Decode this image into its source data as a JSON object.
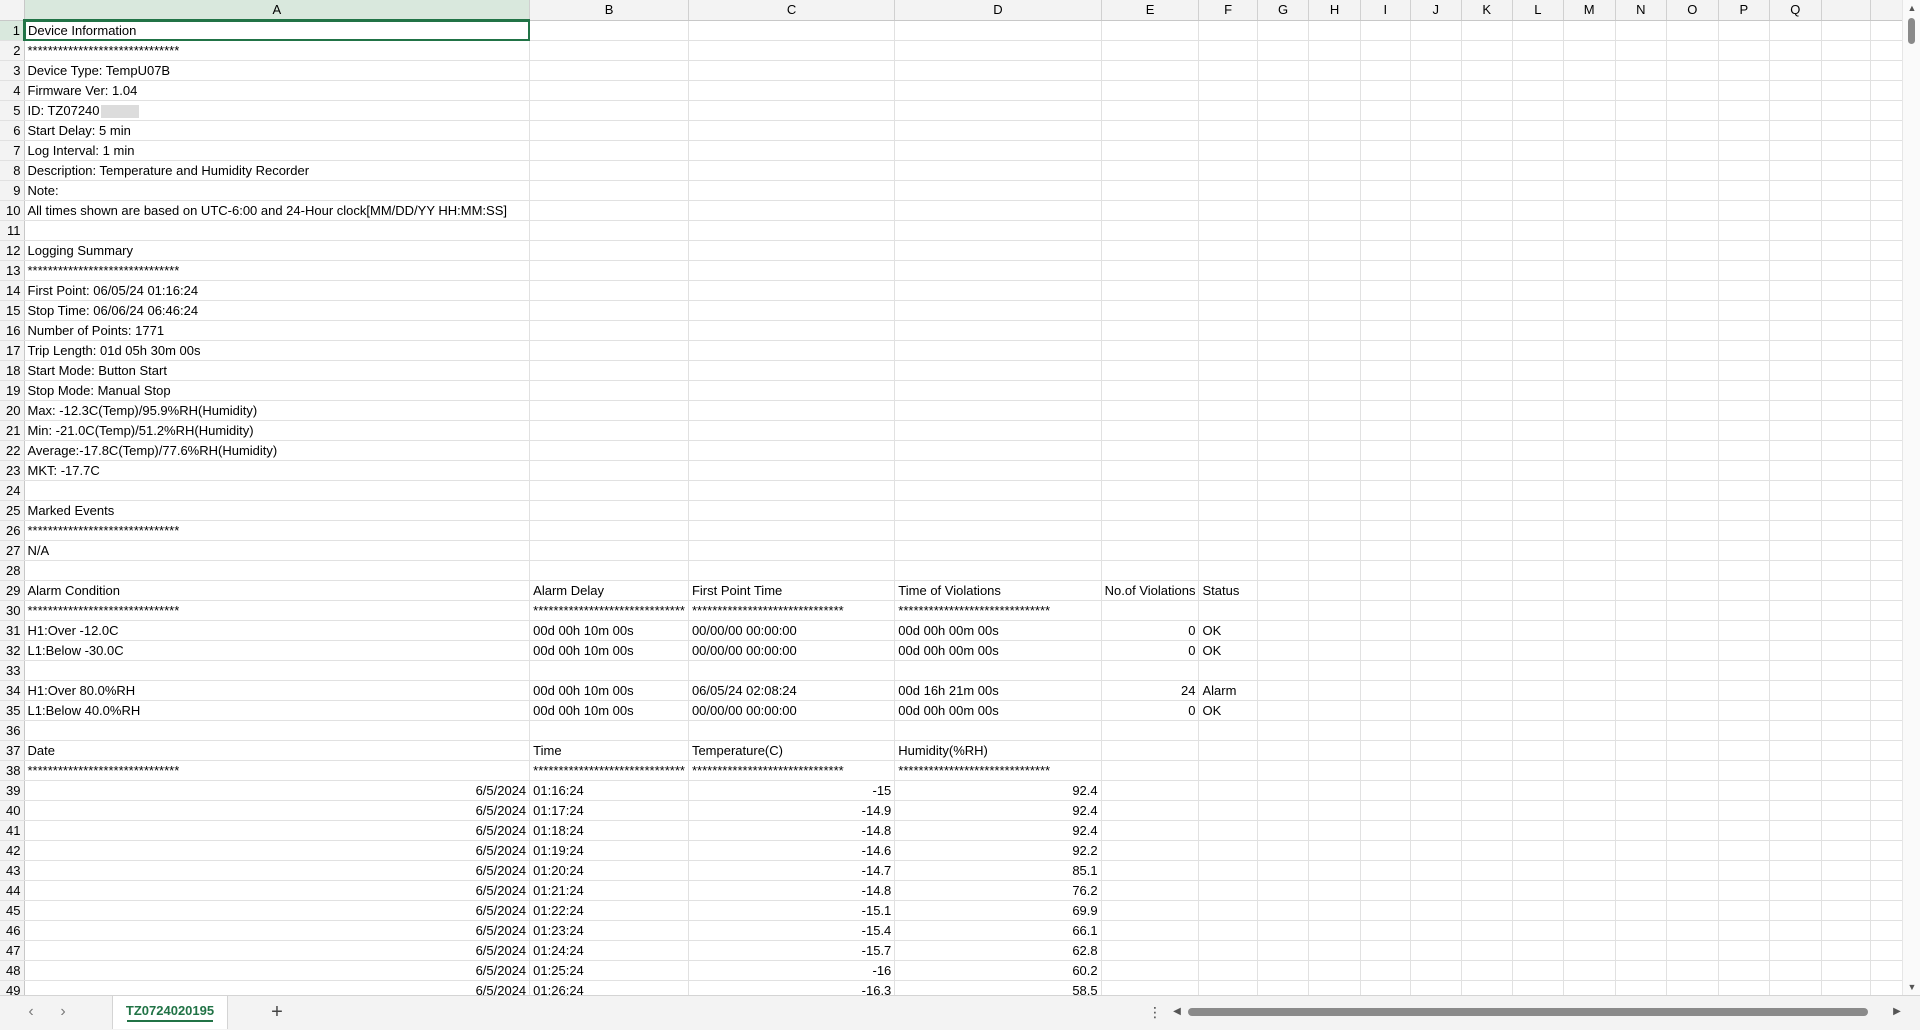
{
  "columns": [
    "A",
    "B",
    "C",
    "D",
    "E",
    "F",
    "G",
    "H",
    "I",
    "J",
    "K",
    "L",
    "M",
    "N",
    "O",
    "P",
    "Q"
  ],
  "active_cell": "A1",
  "rows": [
    {
      "n": "1",
      "a": "Device Information"
    },
    {
      "n": "2",
      "a": "******************************"
    },
    {
      "n": "3",
      "a": "Device Type:    TempU07B"
    },
    {
      "n": "4",
      "a": "Firmware Ver:   1.04"
    },
    {
      "n": "5",
      "a": "ID:          TZ07240",
      "redacted": true
    },
    {
      "n": "6",
      "a": "Start Delay:    5 min"
    },
    {
      "n": "7",
      "a": "Log Interval:   1 min"
    },
    {
      "n": "8",
      "a": "Description:    Temperature and Humidity Recorder"
    },
    {
      "n": "9",
      "a": "Note:"
    },
    {
      "n": "10",
      "a": "All times shown are based on UTC-6:00 and 24-Hour clock[MM/DD/YY HH:MM:SS]"
    },
    {
      "n": "11"
    },
    {
      "n": "12",
      "a": "Logging Summary"
    },
    {
      "n": "13",
      "a": "******************************"
    },
    {
      "n": "14",
      "a": "First Point:   06/05/24 01:16:24"
    },
    {
      "n": "15",
      "a": "Stop Time:     06/06/24 06:46:24"
    },
    {
      "n": "16",
      "a": "Number of Points:   1771"
    },
    {
      "n": "17",
      "a": "Trip Length:   01d 05h 30m 00s"
    },
    {
      "n": "18",
      "a": "Start Mode:    Button Start"
    },
    {
      "n": "19",
      "a": "Stop Mode:     Manual Stop"
    },
    {
      "n": "20",
      "a": "Max:    -12.3C(Temp)/95.9%RH(Humidity)"
    },
    {
      "n": "21",
      "a": "Min:    -21.0C(Temp)/51.2%RH(Humidity)"
    },
    {
      "n": "22",
      "a": "Average:-17.8C(Temp)/77.6%RH(Humidity)"
    },
    {
      "n": "23",
      "a": "MKT:    -17.7C"
    },
    {
      "n": "24"
    },
    {
      "n": "25",
      "a": "Marked Events"
    },
    {
      "n": "26",
      "a": "******************************"
    },
    {
      "n": "27",
      "a": "N/A"
    },
    {
      "n": "28"
    },
    {
      "n": "29",
      "a": "Alarm Condition",
      "b": "Alarm Delay",
      "c": "First Point Time",
      "d": "Time of Violations",
      "e": "No.of Violations",
      "f": "Status"
    },
    {
      "n": "30",
      "a": "******************************",
      "b": "******************************",
      "c": "******************************",
      "d": "******************************"
    },
    {
      "n": "31",
      "a": "H1:Over -12.0C",
      "b": "00d 00h 10m 00s",
      "c": "00/00/00 00:00:00",
      "d": "00d 00h 00m 00s",
      "e": "0",
      "f": "OK"
    },
    {
      "n": "32",
      "a": "L1:Below -30.0C",
      "b": "00d 00h 10m 00s",
      "c": "00/00/00 00:00:00",
      "d": "00d 00h 00m 00s",
      "e": "0",
      "f": "OK"
    },
    {
      "n": "33"
    },
    {
      "n": "34",
      "a": "H1:Over 80.0%RH",
      "b": "00d 00h 10m 00s",
      "c": "06/05/24 02:08:24",
      "d": "00d 16h 21m 00s",
      "e": "24",
      "f": "Alarm"
    },
    {
      "n": "35",
      "a": "L1:Below 40.0%RH",
      "b": "00d 00h 10m 00s",
      "c": "00/00/00 00:00:00",
      "d": "00d 00h 00m 00s",
      "e": "0",
      "f": "OK"
    },
    {
      "n": "36"
    },
    {
      "n": "37",
      "a": "Date",
      "b": "Time",
      "c": "Temperature(C)",
      "d": "Humidity(%RH)"
    },
    {
      "n": "38",
      "a": "******************************",
      "b": "******************************",
      "c": "******************************",
      "d": "******************************"
    },
    {
      "n": "39",
      "a": "6/5/2024",
      "b": "01:16:24",
      "c": "-15",
      "d": "92.4",
      "data": true
    },
    {
      "n": "40",
      "a": "6/5/2024",
      "b": "01:17:24",
      "c": "-14.9",
      "d": "92.4",
      "data": true
    },
    {
      "n": "41",
      "a": "6/5/2024",
      "b": "01:18:24",
      "c": "-14.8",
      "d": "92.4",
      "data": true
    },
    {
      "n": "42",
      "a": "6/5/2024",
      "b": "01:19:24",
      "c": "-14.6",
      "d": "92.2",
      "data": true
    },
    {
      "n": "43",
      "a": "6/5/2024",
      "b": "01:20:24",
      "c": "-14.7",
      "d": "85.1",
      "data": true
    },
    {
      "n": "44",
      "a": "6/5/2024",
      "b": "01:21:24",
      "c": "-14.8",
      "d": "76.2",
      "data": true
    },
    {
      "n": "45",
      "a": "6/5/2024",
      "b": "01:22:24",
      "c": "-15.1",
      "d": "69.9",
      "data": true
    },
    {
      "n": "46",
      "a": "6/5/2024",
      "b": "01:23:24",
      "c": "-15.4",
      "d": "66.1",
      "data": true
    },
    {
      "n": "47",
      "a": "6/5/2024",
      "b": "01:24:24",
      "c": "-15.7",
      "d": "62.8",
      "data": true
    },
    {
      "n": "48",
      "a": "6/5/2024",
      "b": "01:25:24",
      "c": "-16",
      "d": "60.2",
      "data": true
    },
    {
      "n": "49",
      "a": "6/5/2024",
      "b": "01:26:24",
      "c": "-16.3",
      "d": "58.5",
      "data": true
    }
  ],
  "sheet_tab": "TZ0724020195",
  "bottom": {
    "prev_icon": "chevron-left-icon",
    "next_icon": "chevron-right-icon",
    "add_icon": "plus-icon",
    "more_icon": "more-vertical-icon",
    "add_glyph": "+",
    "more_glyph": "⋮"
  },
  "colors": {
    "accent": "#217346",
    "header_bg": "#f3f3f3",
    "gridline": "#e1e1e1"
  }
}
